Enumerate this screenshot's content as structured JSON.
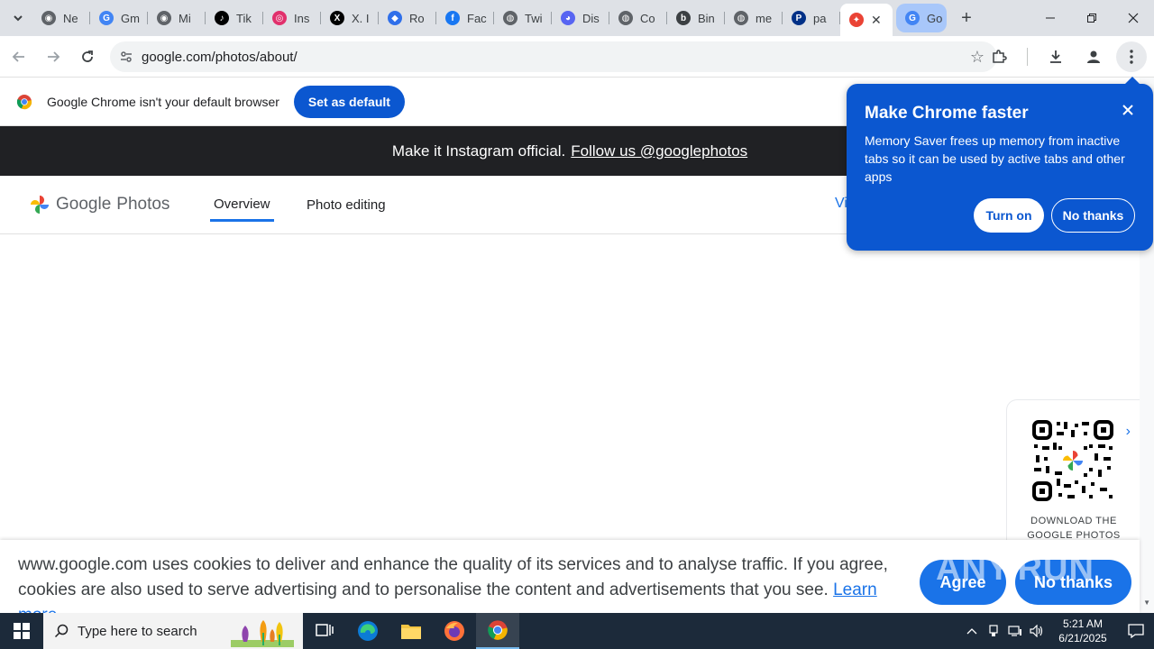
{
  "tabs": [
    {
      "label": "Ne",
      "icon": "incognito-icon",
      "color": "#5f6368"
    },
    {
      "label": "Gm",
      "icon": "google-icon",
      "color": "#4285f4"
    },
    {
      "label": "Mi",
      "icon": "incognito-icon",
      "color": "#5f6368"
    },
    {
      "label": "Tik",
      "icon": "tiktok-icon",
      "color": "#000000"
    },
    {
      "label": "Ins",
      "icon": "instagram-icon",
      "color": "#e1306c"
    },
    {
      "label": "X. I",
      "icon": "x-icon",
      "color": "#000000"
    },
    {
      "label": "Ro",
      "icon": "roblox-icon",
      "color": "#2f6fea"
    },
    {
      "label": "Fac",
      "icon": "facebook-icon",
      "color": "#1877f2"
    },
    {
      "label": "Twi",
      "icon": "globe-icon",
      "color": "#5f6368"
    },
    {
      "label": "Dis",
      "icon": "discord-icon",
      "color": "#5865f2"
    },
    {
      "label": "Co",
      "icon": "globe-icon",
      "color": "#5f6368"
    },
    {
      "label": "Bin",
      "icon": "bing-icon",
      "color": "#3c4043"
    },
    {
      "label": "me",
      "icon": "globe-icon",
      "color": "#5f6368"
    },
    {
      "label": "pa",
      "icon": "paypal-icon",
      "color": "#003087"
    },
    {
      "label": "",
      "icon": "google-photos-icon",
      "color": "#ea4335"
    },
    {
      "label": "Go",
      "icon": "google-icon",
      "color": "#4285f4"
    }
  ],
  "toolbar": {
    "url": "google.com/photos/about/"
  },
  "infobar": {
    "message": "Google Chrome isn't your default browser",
    "button": "Set as default"
  },
  "banner": {
    "text": "Make it Instagram official.",
    "link": "Follow us @googlephotos"
  },
  "sitenav": {
    "logo_google": "Google",
    "logo_photos": "Photos",
    "overview": "Overview",
    "photo_editing": "Photo editing",
    "partial": "Vi"
  },
  "qr": {
    "line1": "DOWNLOAD THE",
    "line2": "GOOGLE PHOTOS"
  },
  "cookie": {
    "text": "www.google.com uses cookies to deliver and enhance the quality of its services and to analyse traffic. If you agree, cookies are also used to serve advertising and to personalise the content and advertisements that you see.",
    "learn_more": "Learn more",
    "agree": "Agree",
    "no_thanks": "No thanks"
  },
  "popup": {
    "title": "Make Chrome faster",
    "body": "Memory Saver frees up memory from inactive tabs so it can be used by active tabs and other apps",
    "turn_on": "Turn on",
    "no_thanks": "No thanks"
  },
  "watermark": "ANY.RUN",
  "taskbar": {
    "search_placeholder": "Type here to search",
    "time": "5:21 AM",
    "date": "6/21/2025"
  },
  "colors": {
    "chrome_blue": "#0b57d0",
    "link_blue": "#1a73e8"
  }
}
